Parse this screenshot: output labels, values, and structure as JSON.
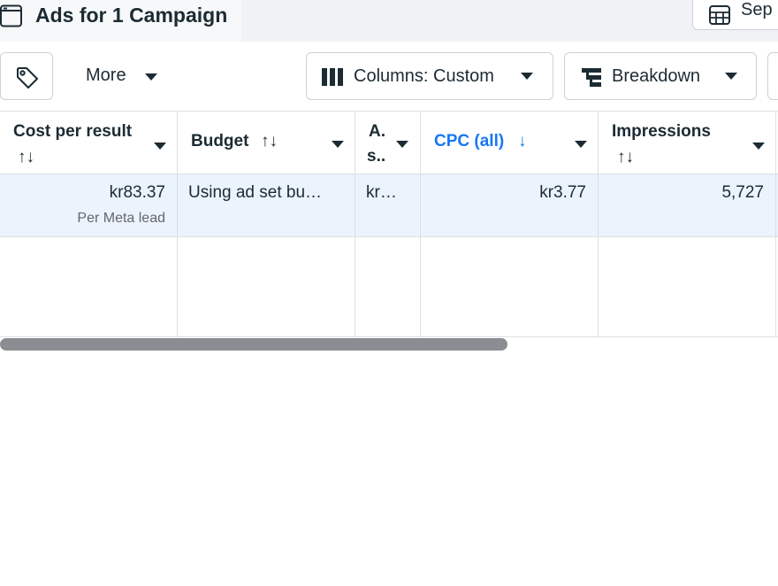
{
  "header": {
    "title": "Ads for 1 Campaign",
    "date_label": "Sep"
  },
  "toolbar": {
    "more_label": "More",
    "columns_label": "Columns: Custom",
    "breakdown_label": "Breakdown"
  },
  "table": {
    "columns": [
      {
        "line1": "Cost per result",
        "line2": "↑↓"
      },
      {
        "label": "Budget",
        "sort": "↑↓"
      },
      {
        "line1": "A.",
        "line2": "s.."
      },
      {
        "label": "CPC (all)",
        "sort": "↓",
        "sorted": true
      },
      {
        "line1": "Impressions",
        "line2": "↑↓"
      }
    ],
    "row": {
      "cost_per_result": "kr83.37",
      "cost_per_result_sub": "Per Meta lead",
      "budget": "Using ad set bu…",
      "col3": "kr…",
      "cpc_all": "kr3.77",
      "impressions": "5,727"
    }
  },
  "colors": {
    "accent": "#1877f2",
    "selected_row": "#ebf3fd",
    "scrollbar": "#8a8d91"
  }
}
